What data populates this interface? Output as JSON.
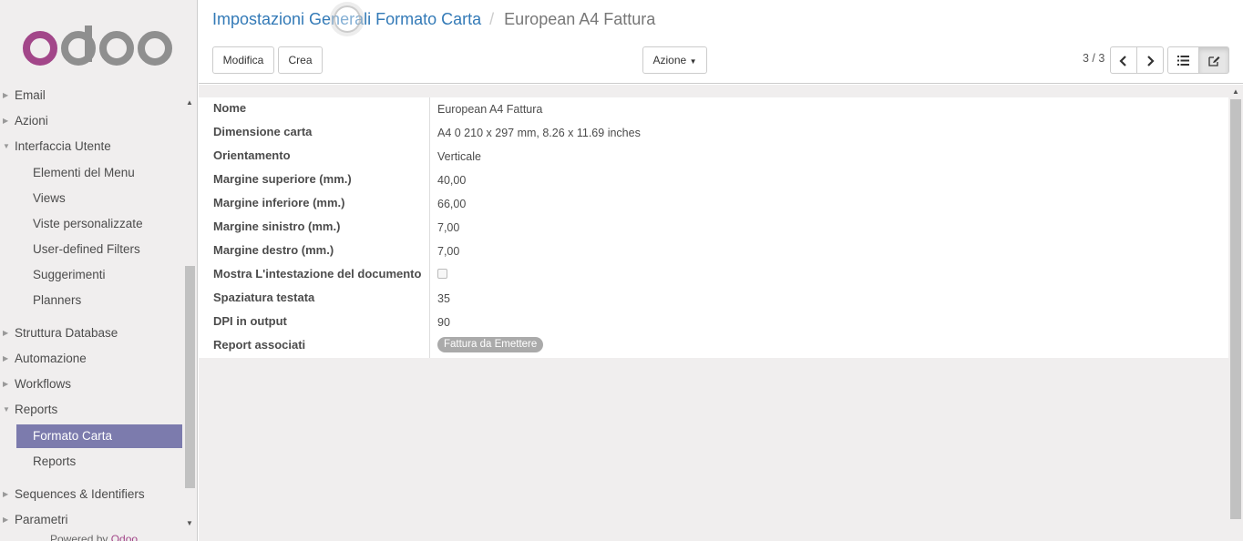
{
  "sidebar": {
    "logo_text": "odoo",
    "items": [
      {
        "label": "Email",
        "level": "top",
        "expanded": false
      },
      {
        "label": "Azioni",
        "level": "top",
        "expanded": false
      },
      {
        "label": "Interfaccia Utente",
        "level": "top",
        "expanded": true
      },
      {
        "label": "Elementi del Menu",
        "level": "sub"
      },
      {
        "label": "Views",
        "level": "sub"
      },
      {
        "label": "Viste personalizzate",
        "level": "sub"
      },
      {
        "label": "User-defined Filters",
        "level": "sub"
      },
      {
        "label": "Suggerimenti",
        "level": "sub"
      },
      {
        "label": "Planners",
        "level": "sub"
      },
      {
        "label": "Struttura Database",
        "level": "top",
        "expanded": false
      },
      {
        "label": "Automazione",
        "level": "top",
        "expanded": false
      },
      {
        "label": "Workflows",
        "level": "top",
        "expanded": false
      },
      {
        "label": "Reports",
        "level": "top",
        "expanded": true
      },
      {
        "label": "Formato Carta",
        "level": "sub",
        "active": true
      },
      {
        "label": "Reports",
        "level": "sub"
      },
      {
        "label": "Sequences & Identifiers",
        "level": "top",
        "expanded": false
      },
      {
        "label": "Parametri",
        "level": "top",
        "expanded": false
      }
    ],
    "powered_by": "Powered by",
    "powered_brand": "Odoo"
  },
  "header": {
    "breadcrumb_parent": "Impostazioni Generali Formato Carta",
    "breadcrumb_separator": "/",
    "breadcrumb_current": "European A4 Fattura",
    "edit_label": "Modifica",
    "create_label": "Crea",
    "action_label": "Azione",
    "pager": "3 / 3"
  },
  "form": {
    "fields": [
      {
        "label": "Nome",
        "value": "European A4 Fattura"
      },
      {
        "label": "Dimensione carta",
        "value": "A4 0 210 x 297 mm, 8.26 x 11.69 inches"
      },
      {
        "label": "Orientamento",
        "value": "Verticale"
      },
      {
        "label": "Margine superiore (mm.)",
        "value": "40,00"
      },
      {
        "label": "Margine inferiore (mm.)",
        "value": "66,00"
      },
      {
        "label": "Margine sinistro (mm.)",
        "value": "7,00"
      },
      {
        "label": "Margine destro (mm.)",
        "value": "7,00"
      },
      {
        "label": "Mostra L'intestazione del documento",
        "value": "",
        "checked": false
      },
      {
        "label": "Spaziatura testata",
        "value": "35"
      },
      {
        "label": "DPI in output",
        "value": "90"
      },
      {
        "label": "Report associati",
        "value": "Fattura da Emettere"
      }
    ]
  },
  "colors": {
    "brand_purple": "#a24689",
    "active_menu": "#7c7bad",
    "link_blue": "#337ab7",
    "logo_gray": "#8f8f8f"
  }
}
